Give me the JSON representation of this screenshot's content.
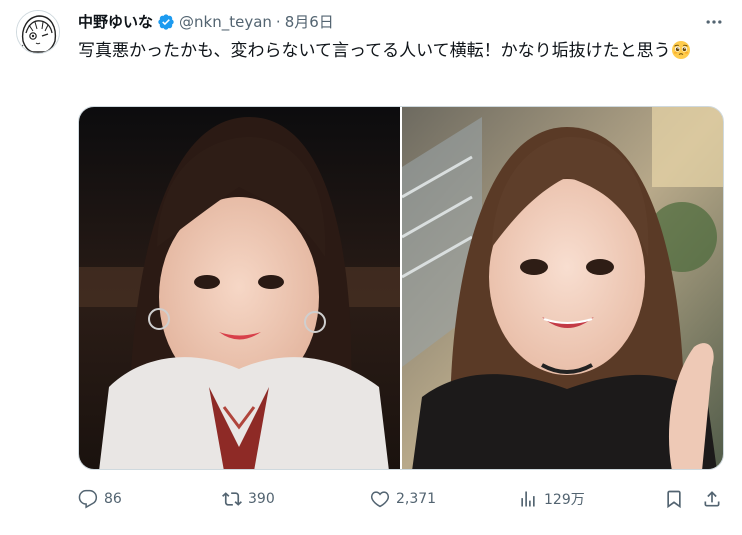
{
  "user": {
    "display_name": "中野ゆいな",
    "handle": "@nkn_teyan",
    "separator": "·",
    "date": "8月6日",
    "avatar_icon": "anime-girl-avatar-icon",
    "verified_icon": "verified-badge-icon",
    "verified_color": "#1d9bf0"
  },
  "tweet": {
    "text": "写真悪かったかも、変わらないて言ってる人いて横転！かなり垢抜けたと思う",
    "emoji": "pleading-face-icon"
  },
  "media": {
    "photos": [
      {
        "name": "photo-before",
        "alt_icon": "photo-icon"
      },
      {
        "name": "photo-after",
        "alt_icon": "photo-icon"
      }
    ]
  },
  "actions": {
    "reply_count": "86",
    "retweet_count": "390",
    "like_count": "2,371",
    "views_count": "129万"
  },
  "colors": {
    "text_primary": "#0f1419",
    "text_secondary": "#536471",
    "border": "#cfd9de"
  }
}
